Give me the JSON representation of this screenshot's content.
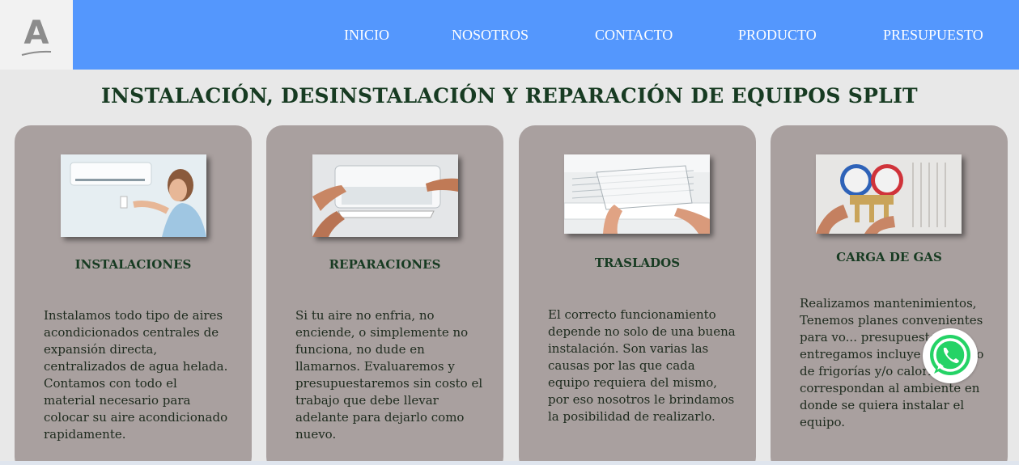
{
  "logo": {
    "letter": "A",
    "icon": "logo-a-icon"
  },
  "nav": {
    "items": [
      {
        "label": "INICIO"
      },
      {
        "label": "NOSOTROS"
      },
      {
        "label": "CONTACTO"
      },
      {
        "label": "PRODUCTO"
      },
      {
        "label": "PRESUPUESTO"
      }
    ]
  },
  "colors": {
    "header": "#5497fd",
    "card": "#a9a09f",
    "heading": "#173b22",
    "whatsapp": "#25d366"
  },
  "page_title": "INSTALACIÓN, DESINSTALACIÓN Y REPARACIÓN DE EQUIPOS SPLIT",
  "services": [
    {
      "image": "woman-with-ac-remote-photo",
      "heading": "INSTALACIONES",
      "text": "Instalamos todo tipo de aires acondicionados centrales de expansión directa, centralizados de agua helada. Contamos con todo el material necesario para colocar su aire acondicionado rapidamente."
    },
    {
      "image": "hands-repairing-ac-photo",
      "heading": "REPARACIONES",
      "text": "Si tu aire no enfria, no enciende, o simplemente no funciona, no dude en llamarnos. Evaluaremos y presupuestaremos sin costo el trabajo que debe llevar adelante para dejarlo como nuevo."
    },
    {
      "image": "ac-filter-removal-photo",
      "heading": "TRASLADOS",
      "text": "El correcto funcionamiento depende no solo de una buena instalación. Son varias las causas por las que cada equipo requiera del mismo, por eso nosotros le brindamos la posibilidad de realizarlo."
    },
    {
      "image": "gas-manifold-gauges-photo",
      "heading": "CARGA DE GAS",
      "text": "Realizamos mantenimientos, Tenemos planes convenientes para vo... presupuesto que entregamos incluye ... cálculo de frigorías y/o calorías que correspondan al ambiente en donde se quiera instalar el equipo."
    }
  ],
  "whatsapp": {
    "icon": "whatsapp-icon"
  }
}
